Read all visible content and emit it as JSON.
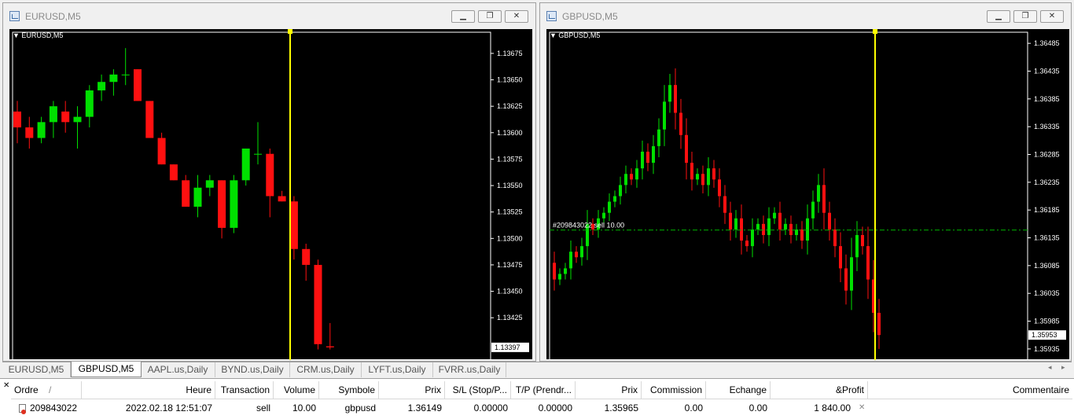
{
  "windows": [
    {
      "title": "EURUSD,M5",
      "chart_label": "EURUSD,M5",
      "price_labels": [
        "1.13675",
        "1.13650",
        "1.13625",
        "1.13600",
        "1.13575",
        "1.13550",
        "1.13525",
        "1.13500",
        "1.13475",
        "1.13450",
        "1.13425"
      ],
      "current_price": "1.13397",
      "colors": {
        "up": "#00e000",
        "down": "#ff1010",
        "marker": "#ffff00"
      }
    },
    {
      "title": "GBPUSD,M5",
      "chart_label": "GBPUSD,M5",
      "price_labels": [
        "1.36485",
        "1.36435",
        "1.36385",
        "1.36335",
        "1.36285",
        "1.36235",
        "1.36185",
        "1.36135",
        "1.36085",
        "1.36035",
        "1.35985",
        "1.35935"
      ],
      "current_price": "1.35953",
      "order_line_label": "#209843022 sell 10.00",
      "colors": {
        "up": "#00e000",
        "down": "#ff1010",
        "marker": "#ffff00",
        "order_line": "#00b000"
      }
    }
  ],
  "window_buttons": {
    "minimize": "▁",
    "restore": "❐",
    "close": "✕"
  },
  "tabs": [
    "EURUSD,M5",
    "GBPUSD,M5",
    "AAPL.us,Daily",
    "BYND.us,Daily",
    "CRM.us,Daily",
    "LYFT.us,Daily",
    "FVRR.us,Daily"
  ],
  "active_tab": "GBPUSD,M5",
  "tab_nav": {
    "left": "◂",
    "right": "▸"
  },
  "terminal": {
    "close": "✕",
    "headers": {
      "order": "Ordre",
      "sort": "/",
      "time": "Heure",
      "transaction": "Transaction",
      "volume": "Volume",
      "symbol": "Symbole",
      "price": "Prix",
      "sl": "S/L (Stop/P...",
      "tp": "T/P (Prendr...",
      "price2": "Prix",
      "commission": "Commission",
      "swap": "Echange",
      "profit": "&Profit",
      "comment": "Commentaire"
    },
    "row": {
      "order": "209843022",
      "time": "2022.02.18 12:51:07",
      "transaction": "sell",
      "volume": "10.00",
      "symbol": "gbpusd",
      "price": "1.36149",
      "sl": "0.00000",
      "tp": "0.00000",
      "price2": "1.35965",
      "commission": "0.00",
      "swap": "0.00",
      "profit": "1 840.00",
      "close": "✕",
      "comment": ""
    }
  },
  "chart_data": [
    {
      "type": "candlestick",
      "title": "EURUSD,M5",
      "ylim": [
        1.13385,
        1.13695
      ],
      "ohlc": [
        [
          1.1362,
          1.1363,
          1.1359,
          1.13605
        ],
        [
          1.13605,
          1.13615,
          1.13585,
          1.13595
        ],
        [
          1.13595,
          1.13615,
          1.1359,
          1.1361
        ],
        [
          1.1361,
          1.1363,
          1.13595,
          1.13625
        ],
        [
          1.1362,
          1.1363,
          1.136,
          1.1361
        ],
        [
          1.1361,
          1.13625,
          1.13585,
          1.13615
        ],
        [
          1.13615,
          1.13645,
          1.13605,
          1.1364
        ],
        [
          1.1364,
          1.13655,
          1.1363,
          1.13648
        ],
        [
          1.13648,
          1.1366,
          1.13635,
          1.13655
        ],
        [
          1.13655,
          1.1368,
          1.13645,
          1.13655
        ],
        [
          1.1366,
          1.1366,
          1.1363,
          1.1363
        ],
        [
          1.1363,
          1.1363,
          1.13595,
          1.13595
        ],
        [
          1.13595,
          1.136,
          1.1357,
          1.1357
        ],
        [
          1.1357,
          1.1357,
          1.13555,
          1.13555
        ],
        [
          1.13555,
          1.1356,
          1.1353,
          1.1353
        ],
        [
          1.1353,
          1.1356,
          1.1352,
          1.13548
        ],
        [
          1.13548,
          1.1356,
          1.1354,
          1.13555
        ],
        [
          1.13555,
          1.13555,
          1.135,
          1.1351
        ],
        [
          1.1351,
          1.1356,
          1.13505,
          1.13555
        ],
        [
          1.13555,
          1.13585,
          1.1355,
          1.13585
        ],
        [
          1.1358,
          1.1361,
          1.1357,
          1.1358
        ],
        [
          1.1358,
          1.13585,
          1.1352,
          1.1354
        ],
        [
          1.1354,
          1.13545,
          1.13535,
          1.13535
        ],
        [
          1.13535,
          1.1354,
          1.1348,
          1.1349
        ],
        [
          1.1349,
          1.13495,
          1.1346,
          1.13475
        ],
        [
          1.13475,
          1.1348,
          1.13395,
          1.134
        ],
        [
          1.13398,
          1.1342,
          1.13395,
          1.13397
        ]
      ]
    },
    {
      "type": "candlestick",
      "title": "GBPUSD,M5",
      "ylim": [
        1.35915,
        1.36505
      ],
      "order_price": 1.36149,
      "close_path": [
        1.3609,
        1.3606,
        1.3607,
        1.3608,
        1.3611,
        1.361,
        1.3612,
        1.3616,
        1.3615,
        1.3617,
        1.3618,
        1.362,
        1.3621,
        1.3623,
        1.3625,
        1.3624,
        1.3626,
        1.3629,
        1.3627,
        1.363,
        1.3633,
        1.3638,
        1.3641,
        1.3636,
        1.3632,
        1.3627,
        1.3624,
        1.3625,
        1.3623,
        1.3626,
        1.3624,
        1.3621,
        1.3618,
        1.3615,
        1.3617,
        1.3613,
        1.3612,
        1.3615,
        1.3616,
        1.3614,
        1.3617,
        1.3618,
        1.3615,
        1.3616,
        1.3614,
        1.3615,
        1.3613,
        1.3617,
        1.362,
        1.3623,
        1.3618,
        1.3615,
        1.3612,
        1.3608,
        1.3604,
        1.361,
        1.3614,
        1.3612,
        1.3606,
        1.36,
        1.3596
      ]
    }
  ]
}
